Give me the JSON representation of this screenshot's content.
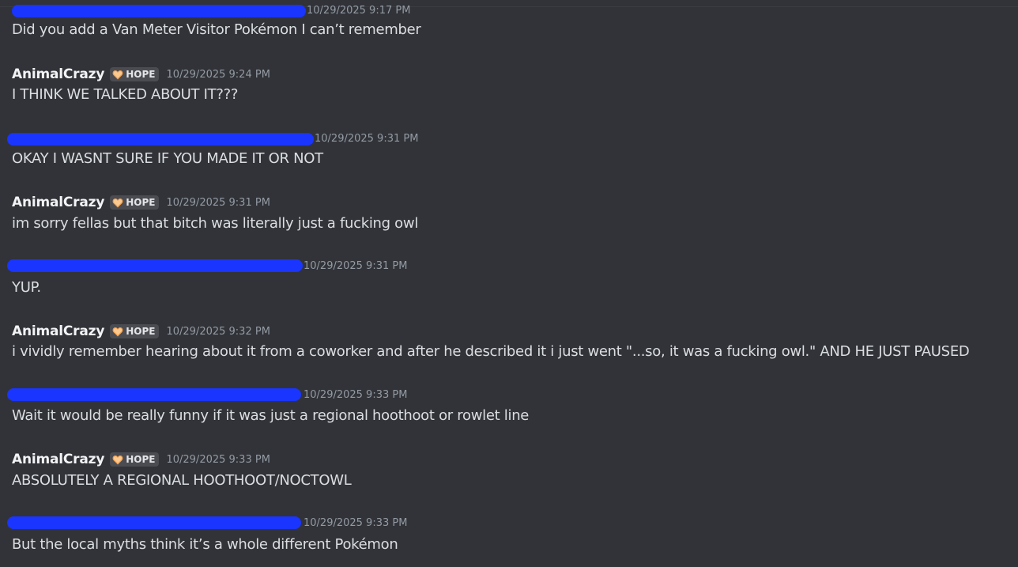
{
  "messages": [
    {
      "author": "",
      "redacted": true,
      "timestamp": "10/29/2025 9:17 PM",
      "content": "Did you add a Van Meter Visitor Pokémon I can’t remember"
    },
    {
      "author": "AnimalCrazy",
      "tag": "HOPE",
      "timestamp": "10/29/2025 9:24 PM",
      "content": "I THINK WE TALKED ABOUT IT???"
    },
    {
      "author": "",
      "redacted": true,
      "timestamp": "10/29/2025 9:31 PM",
      "content": "OKAY I WASNT SURE IF YOU MADE IT OR NOT"
    },
    {
      "author": "AnimalCrazy",
      "tag": "HOPE",
      "timestamp": "10/29/2025 9:31 PM",
      "content": "im sorry fellas but that bitch was literally just a fucking owl"
    },
    {
      "author": "",
      "redacted": true,
      "timestamp": "10/29/2025 9:31 PM",
      "content": "YUP."
    },
    {
      "author": "AnimalCrazy",
      "tag": "HOPE",
      "timestamp": "10/29/2025 9:32 PM",
      "content": "i vividly remember hearing about it from a coworker and after he described it i just went \"...so, it was a fucking owl.\" AND HE JUST PAUSED"
    },
    {
      "author": "",
      "redacted": true,
      "timestamp": "10/29/2025 9:33 PM",
      "content": "Wait it would be really funny if it was just a regional hoothoot or rowlet line"
    },
    {
      "author": "AnimalCrazy",
      "tag": "HOPE",
      "timestamp": "10/29/2025 9:33 PM",
      "content": "ABSOLUTELY A REGIONAL HOOTHOOT/NOCTOWL"
    },
    {
      "author": "",
      "redacted": true,
      "timestamp": "10/29/2025 9:33 PM",
      "content": "But the local myths think it’s a whole different Pokémon"
    }
  ],
  "colors": {
    "background": "#313338",
    "redaction": "#1a35ff",
    "tag_heart": "#f6a04d"
  },
  "icons": {
    "tag": "orange-heart-icon"
  }
}
